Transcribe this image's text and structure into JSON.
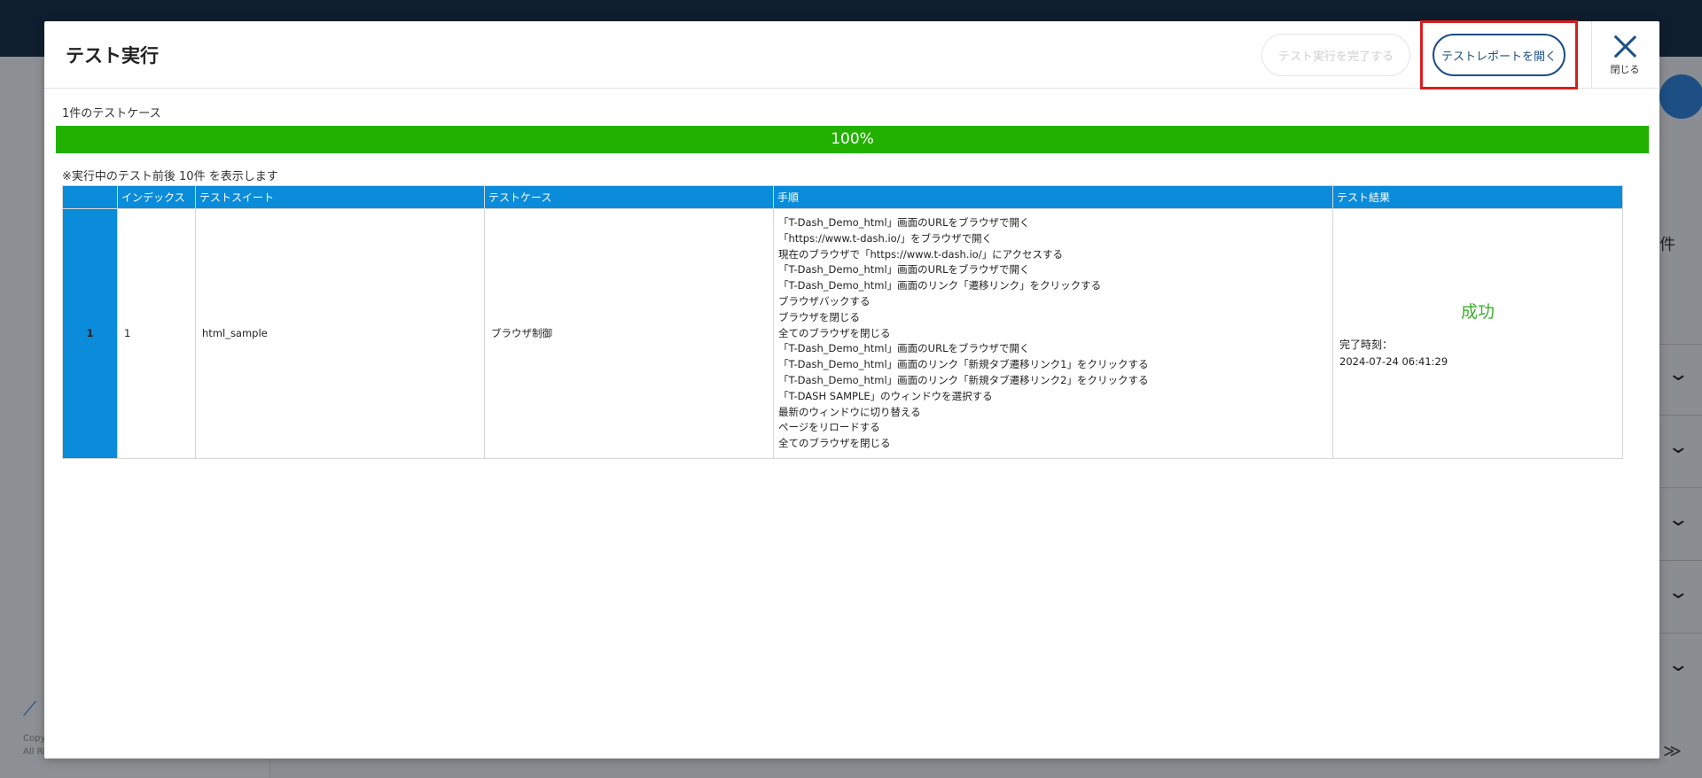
{
  "modal": {
    "title": "テスト実行",
    "complete_button": "テスト実行を完了する",
    "report_button": "テストレポートを開く",
    "close_label": "閉じる",
    "case_count": "1件のテストケース",
    "progress": {
      "value_percent": 100,
      "label": "100%"
    },
    "notice": "※実行中のテスト前後 10件 を表示します"
  },
  "table": {
    "headers": [
      "",
      "インデックス",
      "テストスイート",
      "テストケース",
      "手順",
      "テスト結果"
    ],
    "rows": [
      {
        "row_number": "1",
        "index": "1",
        "suite": "html_sample",
        "case": "ブラウザ制御",
        "steps": [
          "「T-Dash_Demo_html」画面のURLをブラウザで開く",
          "「https://www.t-dash.io/」をブラウザで開く",
          "現在のブラウザで「https://www.t-dash.io/」にアクセスする",
          "「T-Dash_Demo_html」画面のURLをブラウザで開く",
          "「T-Dash_Demo_html」画面のリンク「遷移リンク」をクリックする",
          "ブラウザバックする",
          "ブラウザを閉じる",
          "全てのブラウザを閉じる",
          "「T-Dash_Demo_html」画面のURLをブラウザで開く",
          "「T-Dash_Demo_html」画面のリンク「新規タブ遷移リンク1」をクリックする",
          "「T-Dash_Demo_html」画面のリンク「新規タブ遷移リンク2」をクリックする",
          "「T-DASH SAMPLE」のウィンドウを選択する",
          "最新のウィンドウに切り替える",
          "ページをリロードする",
          "全てのブラウザを閉じる"
        ],
        "result_status": "成功",
        "completed_label": "完了時刻：",
        "completed_time": "2024-07-24 06:41:29"
      }
    ]
  },
  "background": {
    "count_suffix": "件",
    "copyright_1": "Copy",
    "copyright_2": "All Ri"
  },
  "colors": {
    "accent": "#1d4f85",
    "table_header": "#0b8cdb",
    "progress": "#23b100",
    "success": "#3ab02c",
    "highlight": "#d81e1e"
  }
}
